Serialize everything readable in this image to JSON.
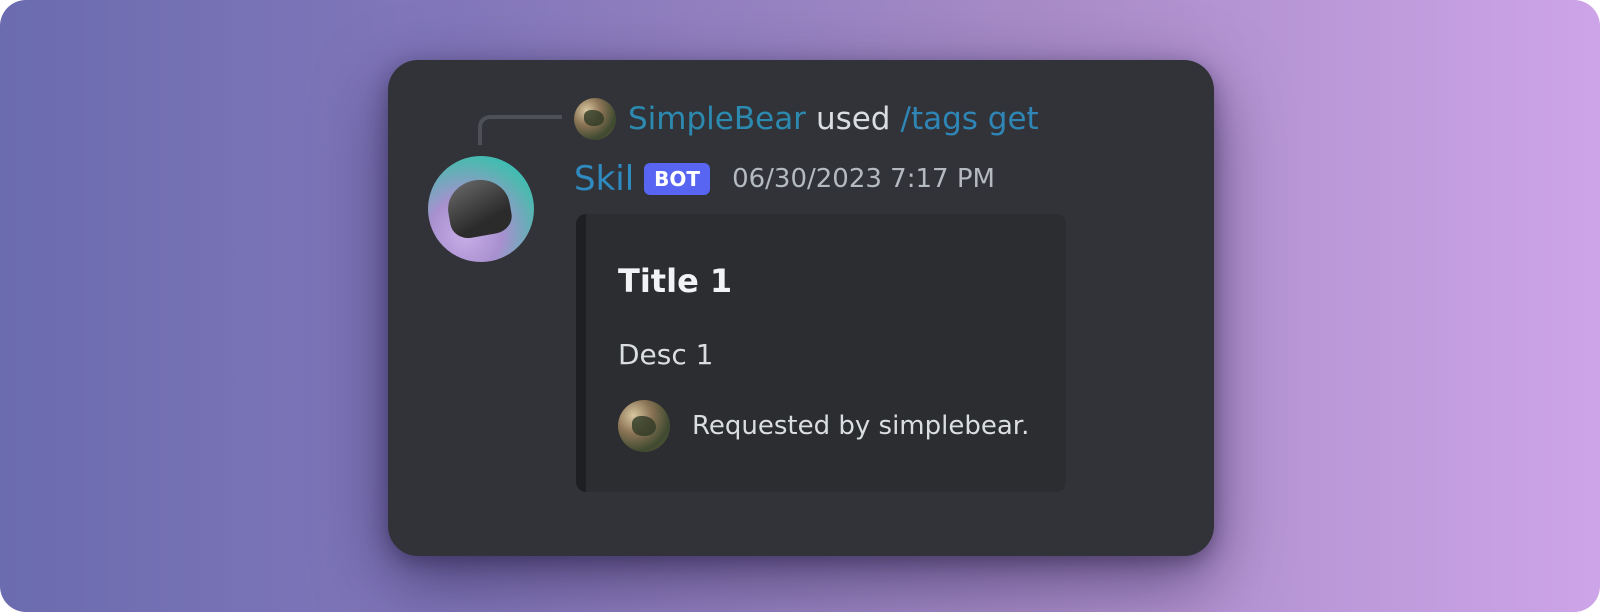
{
  "reply": {
    "user": "SimpleBear",
    "action": "used",
    "command": "/tags get"
  },
  "message": {
    "author": "Skil",
    "badge": "BOT",
    "timestamp": "06/30/2023 7:17 PM"
  },
  "embed": {
    "title": "Title 1",
    "description": "Desc 1",
    "footer": "Requested by simplebear."
  },
  "icons": {
    "reply_avatar": "user-avatar-icon",
    "bot_avatar": "bot-avatar-icon",
    "footer_avatar": "user-avatar-icon"
  },
  "colors": {
    "badge": "#5865f2",
    "link": "#2f86b6",
    "card": "#313338",
    "embed": "#2b2d31"
  }
}
